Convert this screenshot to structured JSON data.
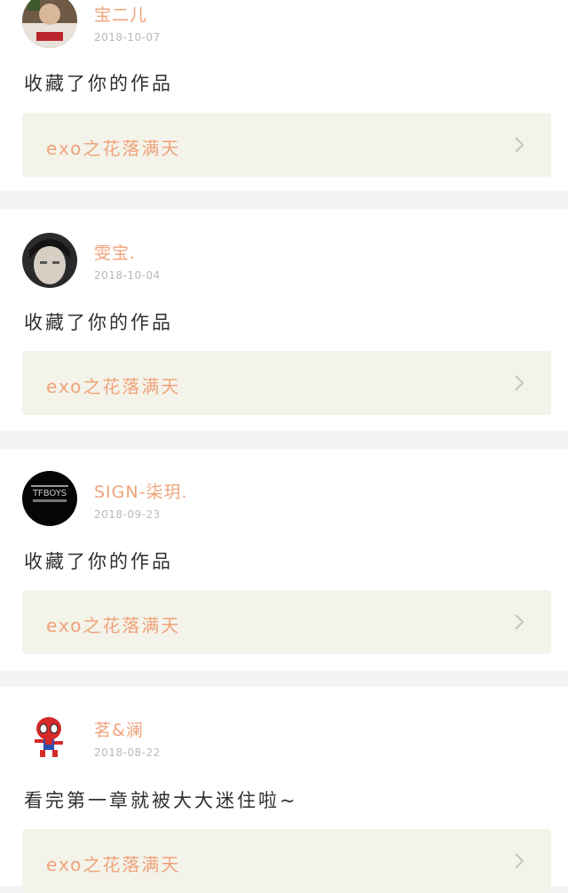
{
  "feed": {
    "items": [
      {
        "username": "宝二儿",
        "date": "2018-10-07",
        "action_text": "收藏了你的作品",
        "work_title": "exo之花落满天",
        "avatar_icon": "avatar-photo-icon"
      },
      {
        "username": "雯宝.",
        "date": "2018-10-04",
        "action_text": "收藏了你的作品",
        "work_title": "exo之花落满天",
        "avatar_icon": "avatar-photo-icon"
      },
      {
        "username": "SIGN-柒玥.",
        "date": "2018-09-23",
        "action_text": "收藏了你的作品",
        "work_title": "exo之花落满天",
        "avatar_icon": "avatar-logo-icon"
      },
      {
        "username": "茗&澜",
        "date": "2018-08-22",
        "action_text": "看完第一章就被大大迷住啦~",
        "work_title": "exo之花落满天",
        "avatar_icon": "spiderman-avatar-icon"
      }
    ]
  },
  "colors": {
    "accent": "#f0a37a",
    "background": "#f3f3f3",
    "card": "#ffffff",
    "link_box": "#f3f3ea"
  }
}
